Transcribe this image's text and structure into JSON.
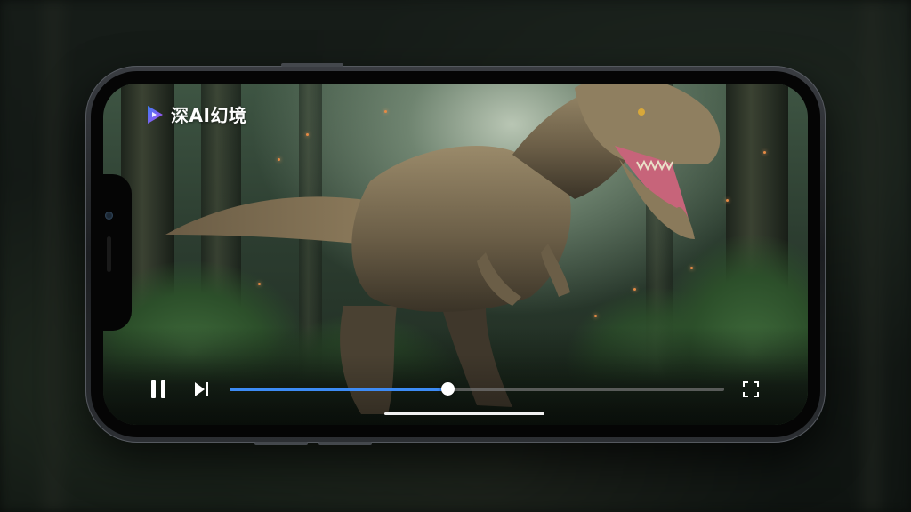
{
  "app": {
    "logo_text": "深AI幻境",
    "logo_icon": "play-triangle-icon",
    "logo_colors": [
      "#3d7cf5",
      "#b04cf0"
    ]
  },
  "player": {
    "state": "playing",
    "progress_fraction": 0.44,
    "accent_color": "#3d8bf5",
    "icons": {
      "pause": "pause-icon",
      "next": "skip-next-icon",
      "fullscreen": "fullscreen-icon"
    }
  }
}
